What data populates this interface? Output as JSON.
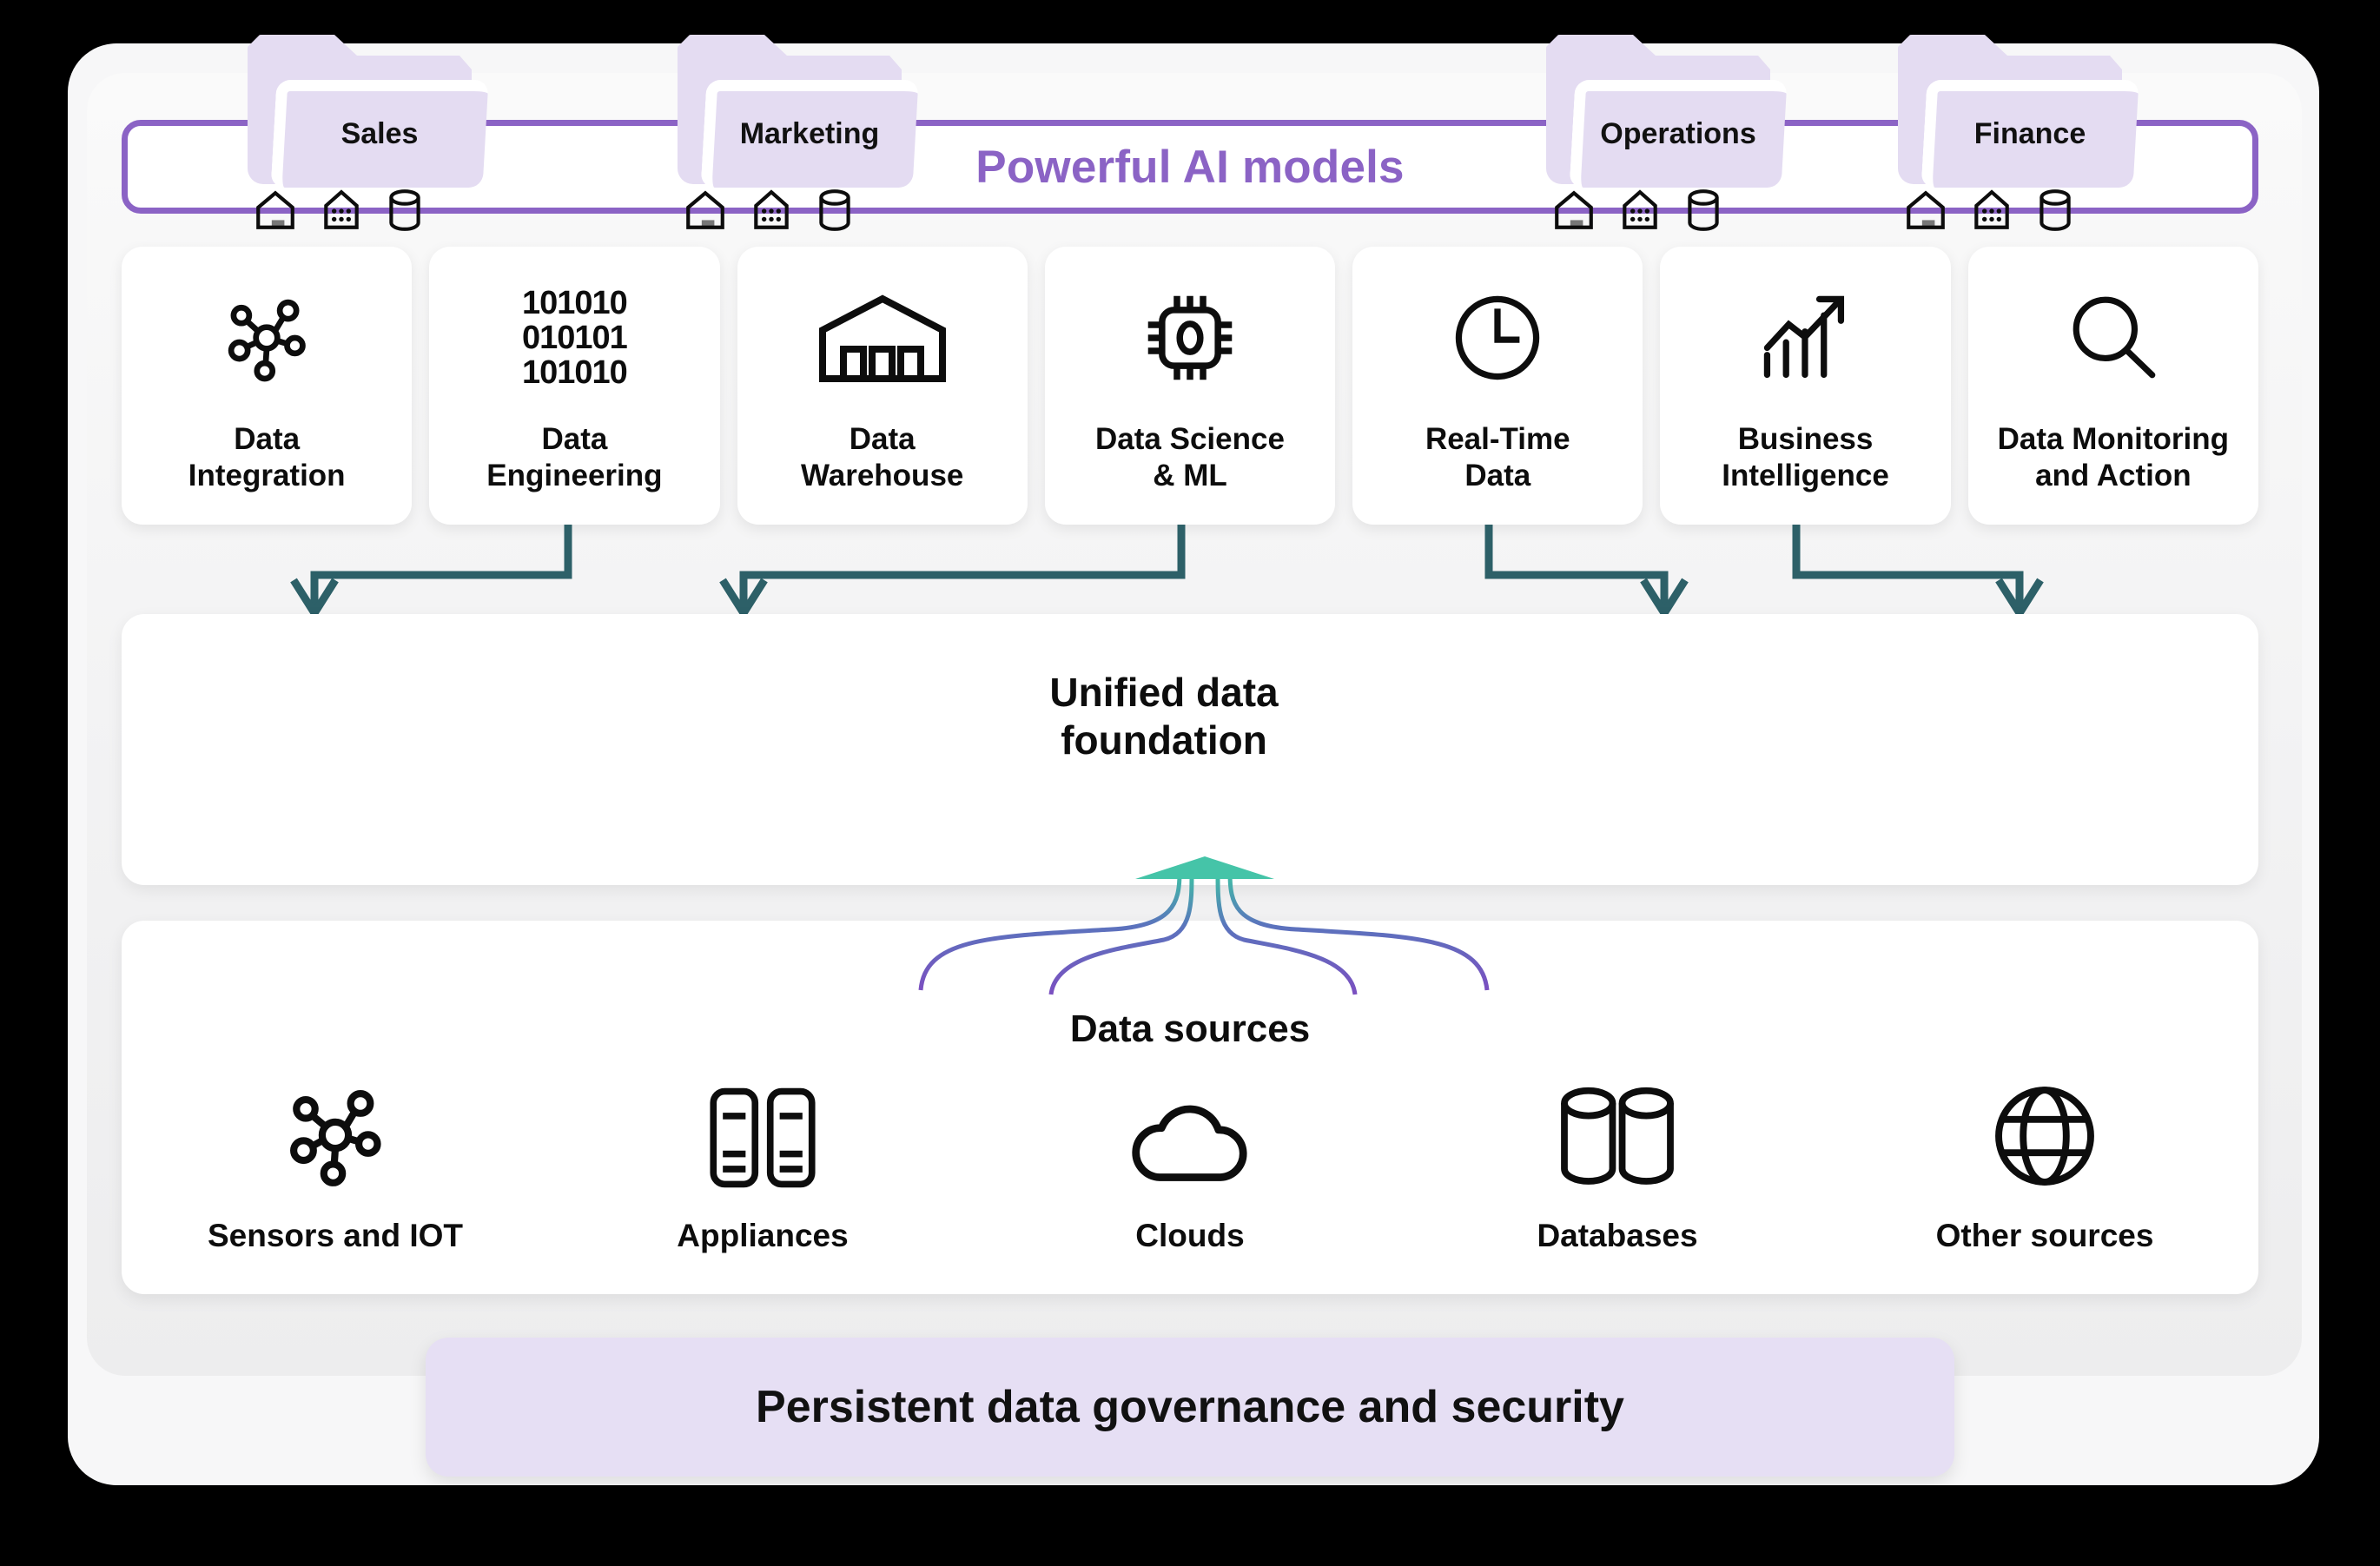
{
  "banner": {
    "title": "Powerful AI models",
    "accent_color": "#8b63c5"
  },
  "capabilities": [
    {
      "label": "Data\nIntegration",
      "icon": "hub-nodes-icon"
    },
    {
      "label": "Data\nEngineering",
      "icon": "binary-digits-icon",
      "binary": [
        "101010",
        "010101",
        "101010"
      ]
    },
    {
      "label": "Data\nWarehouse",
      "icon": "warehouse-icon"
    },
    {
      "label": "Data Science\n& ML",
      "icon": "chip-icon"
    },
    {
      "label": "Real-Time\nData",
      "icon": "clock-icon"
    },
    {
      "label": "Business\nIntelligence",
      "icon": "growth-chart-icon"
    },
    {
      "label": "Data Monitoring\nand Action",
      "icon": "magnifier-icon"
    }
  ],
  "unified": {
    "title": "Unified data\nfoundation",
    "folders": [
      {
        "name": "Sales"
      },
      {
        "name": "Marketing"
      },
      {
        "name": "Operations"
      },
      {
        "name": "Finance"
      }
    ],
    "folder_icons": [
      "home-icon",
      "datamart-building-icon",
      "database-cylinder-icon"
    ],
    "folder_color": "#e4dcf2",
    "arrow_color": "#2d6068"
  },
  "sources": {
    "title": "Data sources",
    "items": [
      {
        "label": "Sensors and IOT",
        "icon": "hub-nodes-icon"
      },
      {
        "label": "Appliances",
        "icon": "server-racks-icon"
      },
      {
        "label": "Clouds",
        "icon": "cloud-icon"
      },
      {
        "label": "Databases",
        "icon": "database-cylinders-icon"
      },
      {
        "label": "Other sources",
        "icon": "globe-icon"
      }
    ],
    "flow_gradient": {
      "from": "#7b4fc0",
      "to": "#3fc0a5"
    }
  },
  "governance": {
    "text": "Persistent data governance and security",
    "background": "#e6dff4"
  }
}
